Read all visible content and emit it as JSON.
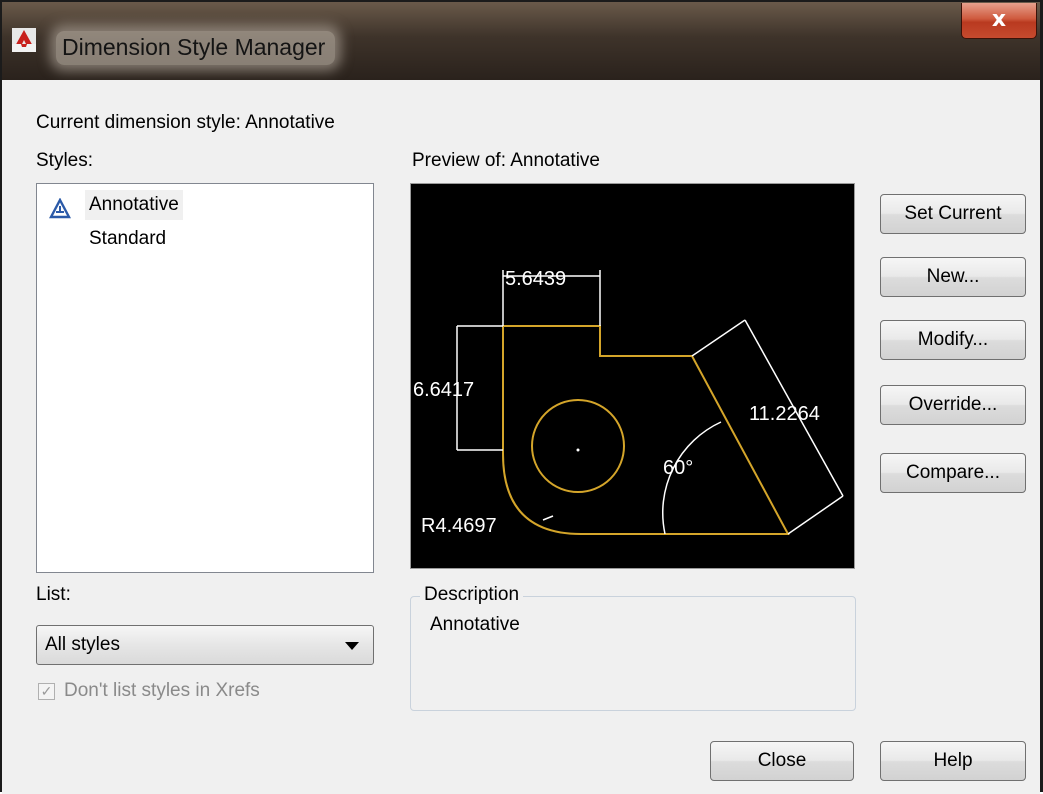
{
  "window": {
    "title": "Dimension Style Manager",
    "close_label": "x"
  },
  "current_style": "Current dimension style: Annotative",
  "styles_label": "Styles:",
  "styles": [
    {
      "name": "Annotative",
      "selected": true,
      "icon": "annotative-icon"
    },
    {
      "name": "Standard",
      "selected": false,
      "icon": ""
    }
  ],
  "preview": {
    "label": "Preview of: Annotative",
    "dims": {
      "top": "5.6439",
      "left": "6.6417",
      "right": "11.2264",
      "angle": "60°",
      "radius": "R4.4697"
    },
    "colors": {
      "geometry": "#d4a52a",
      "dimension": "#ffffff",
      "background": "#000000"
    }
  },
  "buttons": {
    "set_current": "Set Current",
    "new": "New...",
    "modify": "Modify...",
    "override": "Override...",
    "compare": "Compare...",
    "close": "Close",
    "help": "Help"
  },
  "list": {
    "label": "List:",
    "selected": "All styles"
  },
  "xrefs_checkbox": {
    "label": "Don't list styles in Xrefs",
    "checked": true,
    "enabled": false
  },
  "description": {
    "legend": "Description",
    "text": "Annotative"
  }
}
